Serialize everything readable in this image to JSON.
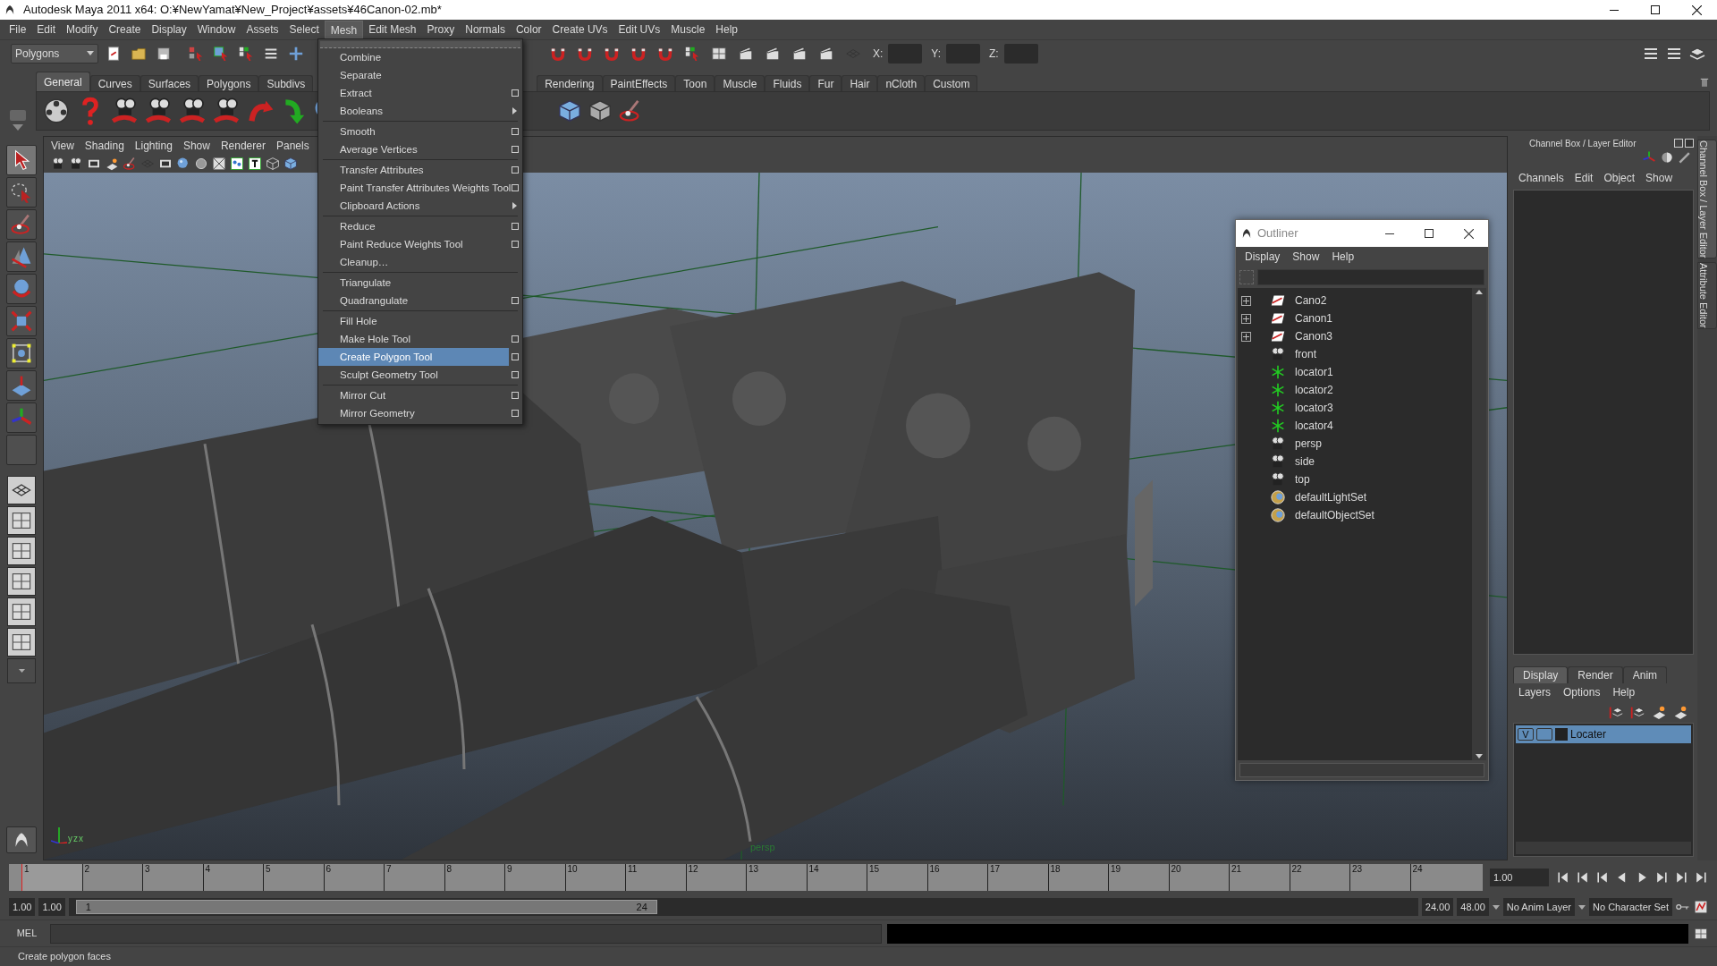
{
  "window": {
    "title": "Autodesk Maya 2011 x64: O:¥NewYamat¥New_Project¥assets¥46Canon-02.mb*"
  },
  "menu_bar": [
    {
      "label": "File",
      "selected": false
    },
    {
      "label": "Edit",
      "selected": false
    },
    {
      "label": "Modify",
      "selected": false
    },
    {
      "label": "Create",
      "selected": false
    },
    {
      "label": "Display",
      "selected": false
    },
    {
      "label": "Window",
      "selected": false
    },
    {
      "label": "Assets",
      "selected": false
    },
    {
      "label": "Select",
      "selected": false
    },
    {
      "label": "Mesh",
      "selected": true
    },
    {
      "label": "Edit Mesh",
      "selected": false
    },
    {
      "label": "Proxy",
      "selected": false
    },
    {
      "label": "Normals",
      "selected": false
    },
    {
      "label": "Color",
      "selected": false
    },
    {
      "label": "Create UVs",
      "selected": false
    },
    {
      "label": "Edit UVs",
      "selected": false
    },
    {
      "label": "Muscle",
      "selected": false
    },
    {
      "label": "Help",
      "selected": false
    }
  ],
  "status_line": {
    "mode": "Polygons",
    "coordinate_labels": [
      "X:",
      "Y:",
      "Z:"
    ]
  },
  "shelf": {
    "tabs": [
      {
        "label": "General",
        "selected": true
      },
      {
        "label": "Curves",
        "selected": false
      },
      {
        "label": "Surfaces",
        "selected": false
      },
      {
        "label": "Polygons",
        "selected": false
      },
      {
        "label": "Subdivs",
        "selected": false
      },
      {
        "label": "Rendering",
        "selected": false
      },
      {
        "label": "PaintEffects",
        "selected": false
      },
      {
        "label": "Toon",
        "selected": false
      },
      {
        "label": "Muscle",
        "selected": false
      },
      {
        "label": "Fluids",
        "selected": false
      },
      {
        "label": "Fur",
        "selected": false
      },
      {
        "label": "Hair",
        "selected": false
      },
      {
        "label": "nCloth",
        "selected": false
      },
      {
        "label": "Custom",
        "selected": false
      }
    ]
  },
  "mesh_menu": {
    "items": [
      {
        "kind": "item",
        "label": "Combine",
        "option_box": false,
        "submenu": false,
        "selected": false
      },
      {
        "kind": "item",
        "label": "Separate",
        "option_box": false,
        "submenu": false,
        "selected": false
      },
      {
        "kind": "item",
        "label": "Extract",
        "option_box": true,
        "submenu": false,
        "selected": false
      },
      {
        "kind": "item",
        "label": "Booleans",
        "option_box": false,
        "submenu": true,
        "selected": false
      },
      {
        "kind": "separator"
      },
      {
        "kind": "item",
        "label": "Smooth",
        "option_box": true,
        "submenu": false,
        "selected": false
      },
      {
        "kind": "item",
        "label": "Average Vertices",
        "option_box": true,
        "submenu": false,
        "selected": false
      },
      {
        "kind": "separator"
      },
      {
        "kind": "item",
        "label": "Transfer Attributes",
        "option_box": true,
        "submenu": false,
        "selected": false
      },
      {
        "kind": "item",
        "label": "Paint Transfer Attributes Weights Tool",
        "option_box": true,
        "submenu": false,
        "selected": false
      },
      {
        "kind": "item",
        "label": "Clipboard Actions",
        "option_box": false,
        "submenu": true,
        "selected": false
      },
      {
        "kind": "separator"
      },
      {
        "kind": "item",
        "label": "Reduce",
        "option_box": true,
        "submenu": false,
        "selected": false
      },
      {
        "kind": "item",
        "label": "Paint Reduce Weights Tool",
        "option_box": true,
        "submenu": false,
        "selected": false
      },
      {
        "kind": "item",
        "label": "Cleanup…",
        "option_box": false,
        "submenu": false,
        "selected": false
      },
      {
        "kind": "separator"
      },
      {
        "kind": "item",
        "label": "Triangulate",
        "option_box": false,
        "submenu": false,
        "selected": false
      },
      {
        "kind": "item",
        "label": "Quadrangulate",
        "option_box": true,
        "submenu": false,
        "selected": false
      },
      {
        "kind": "separator"
      },
      {
        "kind": "item",
        "label": "Fill Hole",
        "option_box": false,
        "submenu": false,
        "selected": false
      },
      {
        "kind": "item",
        "label": "Make Hole Tool",
        "option_box": true,
        "submenu": false,
        "selected": false
      },
      {
        "kind": "item",
        "label": "Create Polygon Tool",
        "option_box": true,
        "submenu": false,
        "selected": true
      },
      {
        "kind": "item",
        "label": "Sculpt Geometry Tool",
        "option_box": true,
        "submenu": false,
        "selected": false
      },
      {
        "kind": "separator"
      },
      {
        "kind": "item",
        "label": "Mirror Cut",
        "option_box": true,
        "submenu": false,
        "selected": false
      },
      {
        "kind": "item",
        "label": "Mirror Geometry",
        "option_box": true,
        "submenu": false,
        "selected": false
      }
    ]
  },
  "viewport": {
    "menus": [
      "View",
      "Shading",
      "Lighting",
      "Show",
      "Renderer",
      "Panels"
    ],
    "camera_label": "persp",
    "axis_labels": [
      "y",
      "z",
      "x"
    ]
  },
  "outliner": {
    "title": "Outliner",
    "menus": [
      "Display",
      "Show",
      "Help"
    ],
    "items": [
      {
        "label": "Cano2",
        "kind": "transform",
        "expandable": true
      },
      {
        "label": "Canon1",
        "kind": "transform",
        "expandable": true
      },
      {
        "label": "Canon3",
        "kind": "transform",
        "expandable": true
      },
      {
        "label": "front",
        "kind": "camera",
        "expandable": false
      },
      {
        "label": "locator1",
        "kind": "locator",
        "expandable": false
      },
      {
        "label": "locator2",
        "kind": "locator",
        "expandable": false
      },
      {
        "label": "locator3",
        "kind": "locator",
        "expandable": false
      },
      {
        "label": "locator4",
        "kind": "locator",
        "expandable": false
      },
      {
        "label": "persp",
        "kind": "camera",
        "expandable": false
      },
      {
        "label": "side",
        "kind": "camera",
        "expandable": false
      },
      {
        "label": "top",
        "kind": "camera",
        "expandable": false
      },
      {
        "label": "defaultLightSet",
        "kind": "set",
        "expandable": false
      },
      {
        "label": "defaultObjectSet",
        "kind": "set",
        "expandable": false
      }
    ]
  },
  "channel_box": {
    "title": "Channel Box / Layer Editor",
    "menus": [
      "Channels",
      "Edit",
      "Object",
      "Show"
    ],
    "layer_tabs": [
      {
        "label": "Display",
        "selected": true
      },
      {
        "label": "Render",
        "selected": false
      },
      {
        "label": "Anim",
        "selected": false
      }
    ],
    "layer_menus": [
      "Layers",
      "Options",
      "Help"
    ],
    "layers": [
      {
        "visibility": "V",
        "name": "Locater",
        "selected": true
      }
    ]
  },
  "side_tabs": [
    {
      "label": "Channel Box / Layer Editor",
      "selected": true
    },
    {
      "label": "Attribute Editor",
      "selected": false
    }
  ],
  "time_slider": {
    "frames": [
      {
        "label": "1",
        "selected": true
      },
      {
        "label": "2",
        "selected": false
      },
      {
        "label": "3",
        "selected": false
      },
      {
        "label": "4",
        "selected": false
      },
      {
        "label": "5",
        "selected": false
      },
      {
        "label": "6",
        "selected": false
      },
      {
        "label": "7",
        "selected": false
      },
      {
        "label": "8",
        "selected": false
      },
      {
        "label": "9",
        "selected": false
      },
      {
        "label": "10",
        "selected": false
      },
      {
        "label": "11",
        "selected": false
      },
      {
        "label": "12",
        "selected": false
      },
      {
        "label": "13",
        "selected": false
      },
      {
        "label": "14",
        "selected": false
      },
      {
        "label": "15",
        "selected": false
      },
      {
        "label": "16",
        "selected": false
      },
      {
        "label": "17",
        "selected": false
      },
      {
        "label": "18",
        "selected": false
      },
      {
        "label": "19",
        "selected": false
      },
      {
        "label": "20",
        "selected": false
      },
      {
        "label": "21",
        "selected": false
      },
      {
        "label": "22",
        "selected": false
      },
      {
        "label": "23",
        "selected": false
      },
      {
        "label": "24",
        "selected": false
      }
    ],
    "current_time": "1.00"
  },
  "range_slider": {
    "start_time": "1.00",
    "playback_start": "1.00",
    "range_start": "1",
    "range_end": "24",
    "playback_end": "24.00",
    "end_time": "48.00",
    "anim_layer": "No Anim Layer",
    "character_set": "No Character Set"
  },
  "command_line": {
    "label": "MEL"
  },
  "help_line": {
    "text": "Create polygon faces"
  }
}
